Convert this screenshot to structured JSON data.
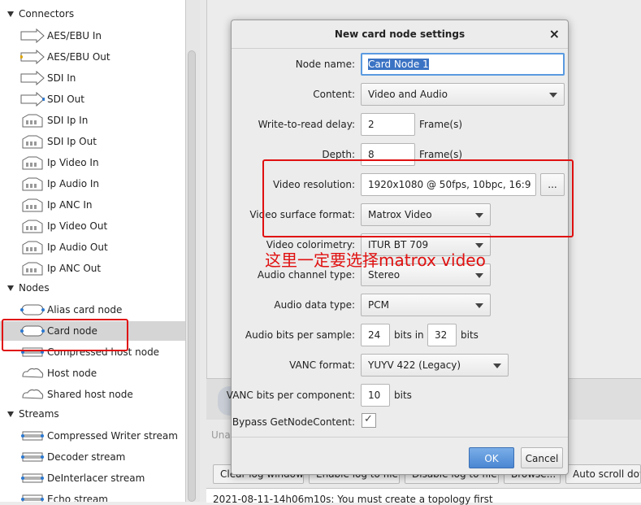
{
  "tree": {
    "categories": {
      "connectors": "Connectors",
      "nodes": "Nodes",
      "streams": "Streams"
    },
    "connectors": [
      "AES/EBU In",
      "AES/EBU Out",
      "SDI In",
      "SDI Out",
      "SDI Ip In",
      "SDI Ip Out",
      "Ip Video In",
      "Ip Audio In",
      "Ip ANC In",
      "Ip Video Out",
      "Ip Audio Out",
      "Ip ANC Out"
    ],
    "nodes": [
      "Alias card node",
      "Card node",
      "Compressed host node",
      "Host node",
      "Shared host node"
    ],
    "streams": [
      "Compressed Writer stream",
      "Decoder stream",
      "DeInterlacer stream",
      "Echo stream"
    ]
  },
  "dialog": {
    "title": "New card node settings",
    "close_glyph": "×",
    "fields": {
      "node_name_label": "Node name:",
      "node_name_value": "Card Node 1",
      "content_label": "Content:",
      "content_value": "Video and Audio",
      "delay_label": "Write-to-read delay:",
      "delay_value": "2",
      "delay_unit": "Frame(s)",
      "depth_label": "Depth:",
      "depth_value": "8",
      "depth_unit": "Frame(s)",
      "resolution_label": "Video resolution:",
      "resolution_value": "1920x1080 @ 50fps, 10bpc, 16:9",
      "resolution_button": "...",
      "surface_label": "Video surface format:",
      "surface_value": "Matrox Video",
      "colorimetry_label": "Video colorimetry:",
      "colorimetry_value": "ITUR BT 709",
      "audio_channel_label": "Audio channel type:",
      "audio_channel_value": "Stereo",
      "audio_data_label": "Audio data type:",
      "audio_data_value": "PCM",
      "audio_bits_label": "Audio bits per sample:",
      "audio_bits_value": "24",
      "audio_bits_in": "bits in",
      "audio_bits_container": "32",
      "audio_bits_unit": "bits",
      "vanc_label": "VANC format:",
      "vanc_value": "YUYV 422 (Legacy)",
      "vanc_bits_label": "VANC bits per component:",
      "vanc_bits_value": "10",
      "vanc_bits_unit": "bits",
      "bypass_label": "Bypass GetNodeContent:",
      "bypass_checked": true,
      "check_glyph": "✓"
    },
    "ok_label": "OK",
    "cancel_label": "Cancel"
  },
  "background": {
    "status_text": "Unas",
    "buttons": [
      "Clear log window",
      "Enable log to file",
      "Disable log to file",
      "Browse...",
      "Auto scroll dow"
    ],
    "log_line": "2021-08-11-14h06m10s: You must create a topology first"
  },
  "annotation": {
    "text": "这里一定要选择matrox video",
    "color": "#e01010"
  }
}
